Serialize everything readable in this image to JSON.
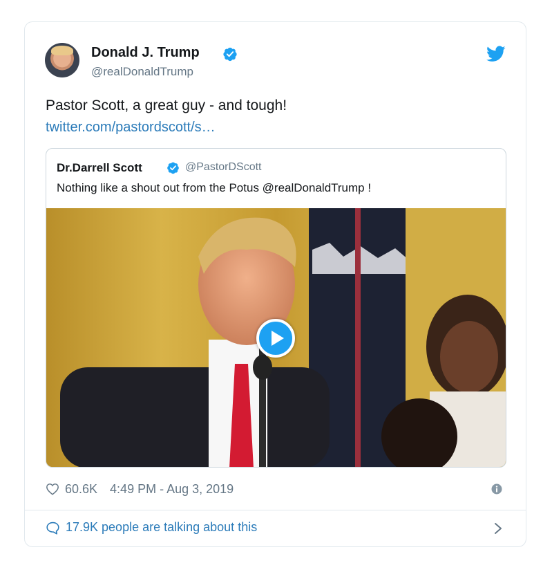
{
  "tweet": {
    "author_name": "Donald J. Trump",
    "author_handle": "@realDonaldTrump",
    "text": "Pastor Scott, a great guy - and tough!",
    "link": "twitter.com/pastordscott/s…",
    "likes": "60.6K",
    "timestamp": "4:49 PM - Aug 3, 2019",
    "talking": "17.9K people are talking about this"
  },
  "quoted": {
    "author_name": "Dr.Darrell Scott",
    "author_handle": "@PastorDScott",
    "text": "Nothing like a shout out from the Potus @realDonaldTrump !"
  },
  "icons": {
    "verified": "verified-badge-icon",
    "brand": "twitter-bird-icon",
    "like": "heart-icon",
    "info": "info-icon",
    "reply": "speech-bubble-icon",
    "chevron": "chevron-right-icon",
    "play": "play-icon"
  },
  "colors": {
    "link": "#2b7bb9",
    "brand": "#1da1f2",
    "muted": "#657786",
    "border": "#e1e8ed"
  }
}
